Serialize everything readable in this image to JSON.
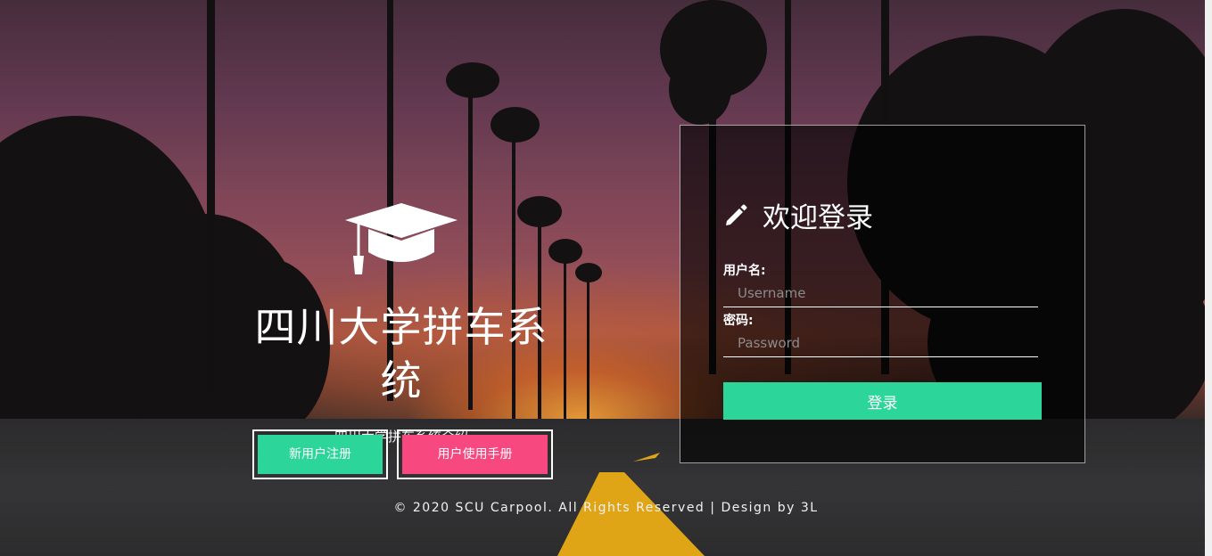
{
  "brand": {
    "icon": "graduation-cap-icon",
    "title": "四川大学拼车系统",
    "subtitle": "四川大学拼车系统介绍"
  },
  "buttons": {
    "register_label": "新用户注册",
    "manual_label": "用户使用手册"
  },
  "login": {
    "icon": "pencil-icon",
    "title": "欢迎登录",
    "username_label": "用户名:",
    "username_placeholder": "Username",
    "password_label": "密码:",
    "password_placeholder": "Password",
    "submit_label": "登录"
  },
  "footer": {
    "text": "© 2020 SCU Carpool. All Rights Reserved | Design by 3L"
  },
  "colors": {
    "accent_green": "#2cd69a",
    "accent_pink": "#f7487f"
  }
}
